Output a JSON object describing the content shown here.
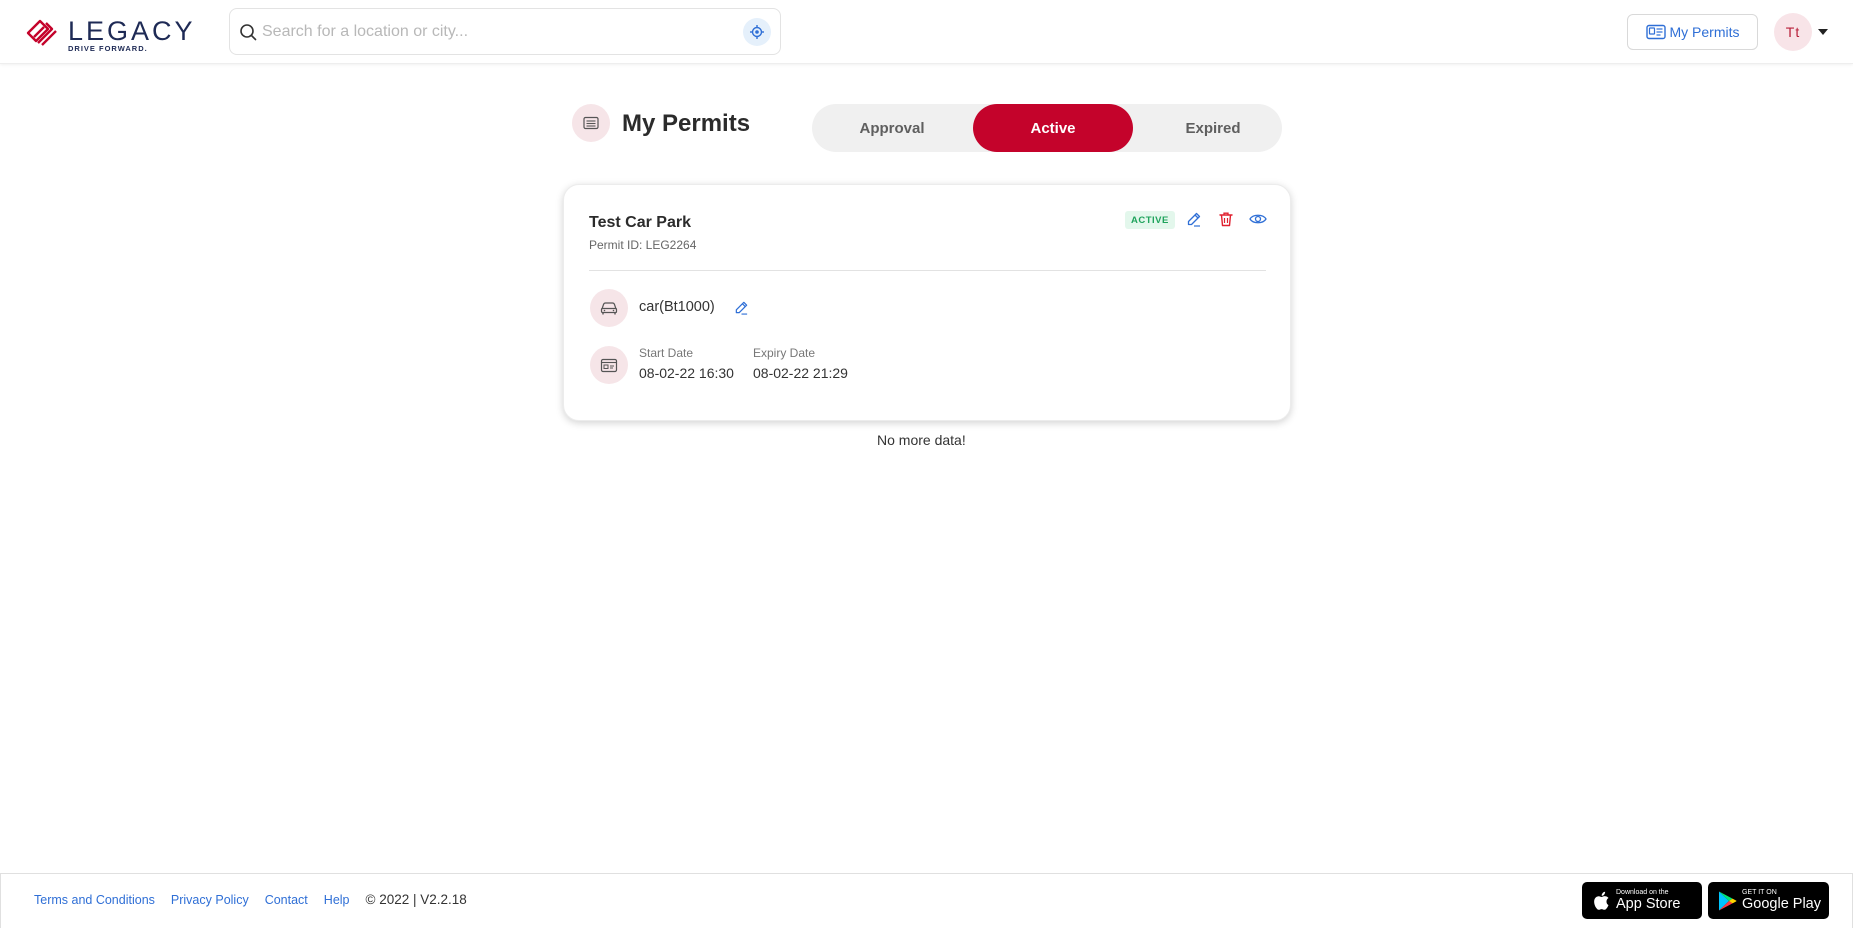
{
  "header": {
    "logo_word": "LEGACY",
    "logo_tagline": "DRIVE FORWARD.",
    "search_placeholder": "Search for a location or city...",
    "my_permits_label": "My Permits",
    "avatar_initials": "Tt"
  },
  "page": {
    "title": "My Permits",
    "tabs": [
      {
        "label": "Approval",
        "selected": false
      },
      {
        "label": "Active",
        "selected": true
      },
      {
        "label": "Expired",
        "selected": false
      }
    ],
    "no_more_text": "No more data!"
  },
  "permit": {
    "car_park": "Test Car Park",
    "permit_id": "Permit ID: LEG2264",
    "status": "ACTIVE",
    "vehicle": "car(Bt1000)",
    "start_label": "Start Date",
    "start_value": "08-02-22 16:30",
    "expiry_label": "Expiry Date",
    "expiry_value": "08-02-22 21:29"
  },
  "footer": {
    "links": [
      "Terms and Conditions",
      "Privacy Policy",
      "Contact",
      "Help"
    ],
    "copyright": "© 2022 | V2.2.18",
    "app_store_small": "Download on the",
    "app_store_big": "App Store",
    "google_play_small": "GET IT ON",
    "google_play_big": "Google Play"
  },
  "colors": {
    "brand_red": "#c4032b",
    "link_blue": "#2f6fd6",
    "active_green": "#1fa35c",
    "icon_bg_pink": "#f6e5e8"
  },
  "icons": [
    "legacy-logo-icon",
    "search-icon",
    "locate-icon",
    "permit-card-icon",
    "car-icon",
    "calendar-icon",
    "edit-icon",
    "trash-icon",
    "eye-icon",
    "apple-icon",
    "google-play-icon"
  ]
}
